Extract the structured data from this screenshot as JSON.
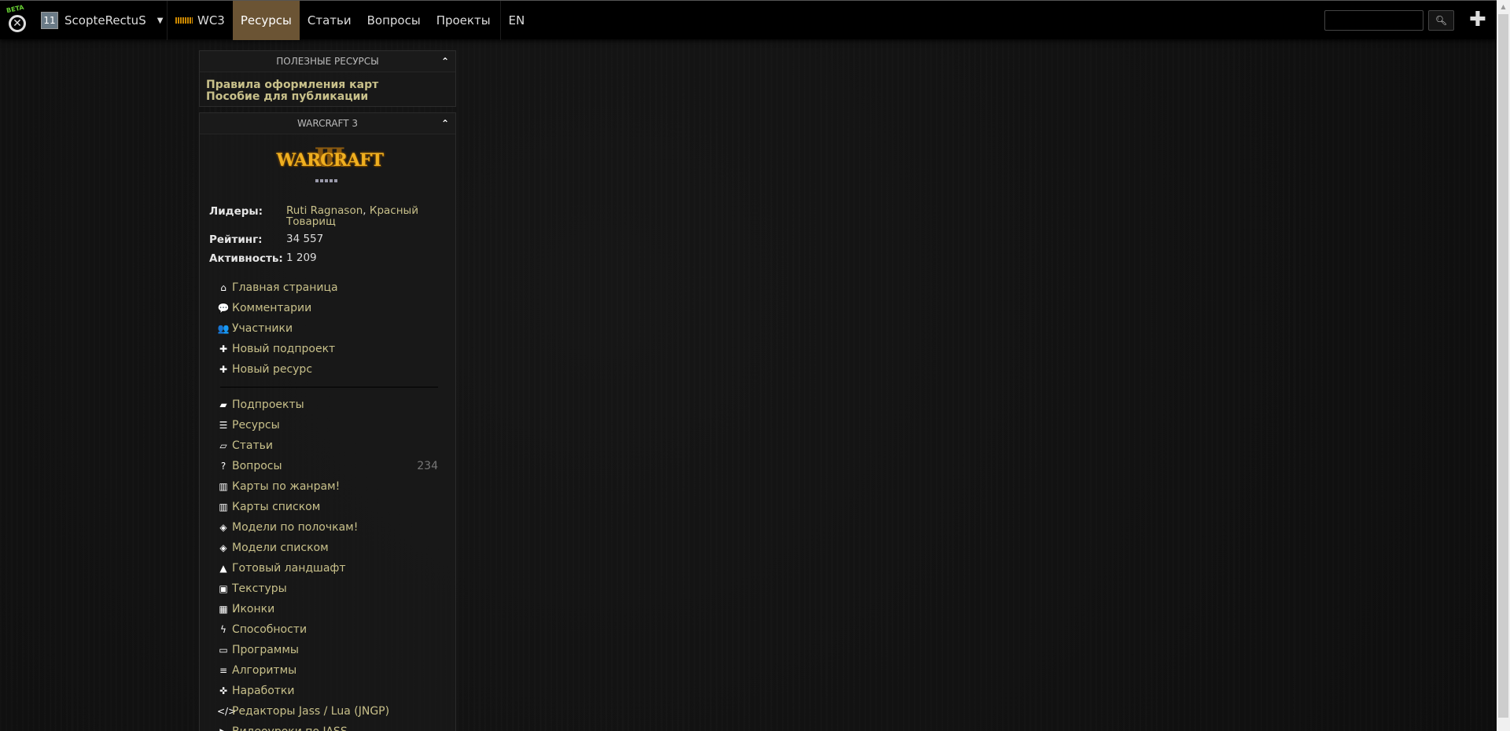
{
  "topbar": {
    "beta": "BETA",
    "user": {
      "level": "11",
      "name": "ScopteRectuS"
    },
    "nav": [
      {
        "label": "WC3",
        "icon": "wc3-icon"
      },
      {
        "label": "Ресурсы",
        "active": true
      },
      {
        "label": "Статьи"
      },
      {
        "label": "Вопросы"
      },
      {
        "label": "Проекты"
      },
      {
        "label": "EN"
      }
    ],
    "search_placeholder": "",
    "search_icon": "search-icon",
    "add_icon": "plus-icon"
  },
  "useful": {
    "title": "ПОЛЕЗНЫЕ РЕСУРСЫ",
    "links": [
      "Правила оформления карт",
      "Пособие для публикации"
    ]
  },
  "project": {
    "title": "WARCRAFT 3",
    "logo_text": "WARCRAFT III",
    "leaders_label": "Лидеры:",
    "leaders": [
      "Ruti Ragnason",
      "Красный Товарищ"
    ],
    "rating_label": "Рейтинг:",
    "rating": "34 557",
    "activity_label": "Активность:",
    "activity": "1 209",
    "actions": [
      {
        "icon": "home-icon",
        "g": "⌂",
        "label": "Главная страница"
      },
      {
        "icon": "comments-icon",
        "g": "💬",
        "label": "Комментарии"
      },
      {
        "icon": "users-icon",
        "g": "👥",
        "label": "Участники"
      },
      {
        "icon": "plus-icon",
        "g": "✚",
        "label": "Новый подпроект"
      },
      {
        "icon": "plus-icon",
        "g": "✚",
        "label": "Новый ресурс"
      }
    ],
    "sections": [
      {
        "icon": "briefcase-icon",
        "g": "▰",
        "label": "Подпроекты"
      },
      {
        "icon": "list-icon",
        "g": "☰",
        "label": "Ресурсы"
      },
      {
        "icon": "book-icon",
        "g": "▱",
        "label": "Статьи"
      },
      {
        "icon": "question-icon",
        "g": "?",
        "label": "Вопросы",
        "count": "234"
      },
      {
        "icon": "map-icon",
        "g": "▥",
        "label": "Карты по жанрам!"
      },
      {
        "icon": "map-icon",
        "g": "▥",
        "label": "Карты списком"
      },
      {
        "icon": "cube-icon",
        "g": "◈",
        "label": "Модели по полочкам!"
      },
      {
        "icon": "cube-icon",
        "g": "◈",
        "label": "Модели списком"
      },
      {
        "icon": "tree-icon",
        "g": "▲",
        "label": "Готовый ландшафт"
      },
      {
        "icon": "image-icon",
        "g": "▣",
        "label": "Текстуры"
      },
      {
        "icon": "grid-icon",
        "g": "▦",
        "label": "Иконки"
      },
      {
        "icon": "bolt-icon",
        "g": "ϟ",
        "label": "Способности"
      },
      {
        "icon": "window-icon",
        "g": "▭",
        "label": "Программы"
      },
      {
        "icon": "ordered-list-icon",
        "g": "≡",
        "label": "Алгоритмы"
      },
      {
        "icon": "puzzle-icon",
        "g": "✜",
        "label": "Наработки"
      },
      {
        "icon": "code-icon",
        "g": "</>",
        "label": "Редакторы Jass / Lua (JNGP)"
      },
      {
        "icon": "youtube-icon",
        "g": "▶",
        "label": "Видеоуроки по JASS"
      }
    ]
  }
}
